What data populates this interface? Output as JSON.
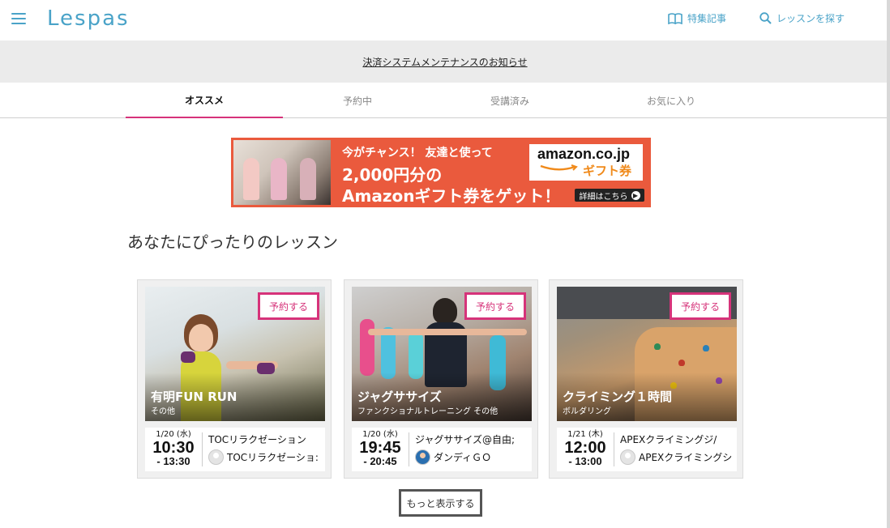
{
  "header": {
    "logo": "Lespas",
    "features_link": "特集記事",
    "search_link": "レッスンを探す"
  },
  "notice": {
    "text": "決済システムメンテナンスのお知らせ"
  },
  "tabs": [
    {
      "label": "オススメ",
      "active": true
    },
    {
      "label": "予約中",
      "active": false
    },
    {
      "label": "受講済み",
      "active": false
    },
    {
      "label": "お気に入り",
      "active": false
    }
  ],
  "banner": {
    "line1": "今がチャンス！ 友達と使って",
    "line2": "2,000円分の",
    "line3": "Amazonギフト券をゲット！",
    "amazon_logo": "amazon.co.jp",
    "gift_label": "ギフト券",
    "detail_label": "詳細はこちら"
  },
  "section": {
    "title": "あなたにぴったりのレッスン"
  },
  "lessons": [
    {
      "reserve_label": "予約する",
      "name": "有明FUN RUN",
      "category": "その他",
      "date": "1/20 (水)",
      "start": "10:30",
      "end": "- 13:30",
      "studio": "TOCリラクゼーション",
      "instructor": "TOCリラクゼーショ:"
    },
    {
      "reserve_label": "予約する",
      "name": "ジャグササイズ",
      "category": "ファンクショナルトレーニング その他",
      "date": "1/20 (水)",
      "start": "19:45",
      "end": "- 20:45",
      "studio": "ジャグササイズ@自由;",
      "instructor": "ダンディＧＯ"
    },
    {
      "reserve_label": "予約する",
      "name": "クライミング１時間",
      "category": "ボルダリング",
      "date": "1/21 (木)",
      "start": "12:00",
      "end": "- 13:00",
      "studio": "APEXクライミングジ/",
      "instructor": "APEXクライミングシ"
    }
  ],
  "more_button": "もっと表示する",
  "colors": {
    "brand": "#4aa3c8",
    "accent": "#d6337a",
    "banner_bg": "#ea5a3d"
  }
}
